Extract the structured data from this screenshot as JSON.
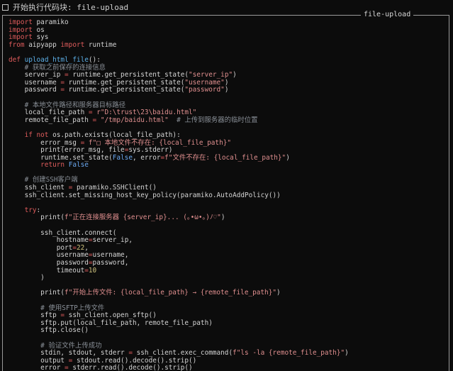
{
  "header": {
    "text": "开始执行代码块: file-upload"
  },
  "panel": {
    "title": "file-upload"
  },
  "code_lines": [
    [
      [
        "kw",
        "import"
      ],
      [
        "p",
        " paramiko"
      ]
    ],
    [
      [
        "kw",
        "import"
      ],
      [
        "p",
        " os"
      ]
    ],
    [
      [
        "kw",
        "import"
      ],
      [
        "p",
        " sys"
      ]
    ],
    [
      [
        "kw",
        "from"
      ],
      [
        "p",
        " aipyapp "
      ],
      [
        "kw",
        "import"
      ],
      [
        "p",
        " runtime"
      ]
    ],
    [],
    [
      [
        "kw",
        "def"
      ],
      [
        "p",
        " "
      ],
      [
        "fn",
        "upload_html_file"
      ],
      [
        "p",
        "():"
      ]
    ],
    [
      [
        "p",
        "    "
      ],
      [
        "com",
        "# 获取之前保存的连接信息"
      ]
    ],
    [
      [
        "p",
        "    server_ip "
      ],
      [
        "op",
        "="
      ],
      [
        "p",
        " runtime.get_persistent_state("
      ],
      [
        "str",
        "\"server_ip\""
      ],
      [
        "p",
        ")"
      ]
    ],
    [
      [
        "p",
        "    username "
      ],
      [
        "op",
        "="
      ],
      [
        "p",
        " runtime.get_persistent_state("
      ],
      [
        "str",
        "\"username\""
      ],
      [
        "p",
        ")"
      ]
    ],
    [
      [
        "p",
        "    password "
      ],
      [
        "op",
        "="
      ],
      [
        "p",
        " runtime.get_persistent_state("
      ],
      [
        "str",
        "\"password\""
      ],
      [
        "p",
        ")"
      ]
    ],
    [],
    [
      [
        "p",
        "    "
      ],
      [
        "com",
        "# 本地文件路径和服务器目标路径"
      ]
    ],
    [
      [
        "p",
        "    local_file_path "
      ],
      [
        "op",
        "="
      ],
      [
        "p",
        " "
      ],
      [
        "str",
        "r\"D:\\trust\\23\\baidu.html\""
      ]
    ],
    [
      [
        "p",
        "    remote_file_path "
      ],
      [
        "op",
        "="
      ],
      [
        "p",
        " "
      ],
      [
        "str",
        "\"/tmp/baidu.html\""
      ],
      [
        "p",
        "  "
      ],
      [
        "com",
        "# 上传到服务器的临时位置"
      ]
    ],
    [],
    [
      [
        "p",
        "    "
      ],
      [
        "kw",
        "if not"
      ],
      [
        "p",
        " os.path.exists(local_file_path):"
      ]
    ],
    [
      [
        "p",
        "        error_msg "
      ],
      [
        "op",
        "="
      ],
      [
        "p",
        " "
      ],
      [
        "str",
        "f\"□ 本地文件不存在: {local_file_path}\""
      ]
    ],
    [
      [
        "p",
        "        print(error_msg, file"
      ],
      [
        "op",
        "="
      ],
      [
        "p",
        "sys.stderr)"
      ]
    ],
    [
      [
        "p",
        "        runtime.set_state("
      ],
      [
        "cn",
        "False"
      ],
      [
        "p",
        ", error"
      ],
      [
        "op",
        "="
      ],
      [
        "str",
        "f\"文件不存在: {local_file_path}\""
      ],
      [
        "p",
        ")"
      ]
    ],
    [
      [
        "p",
        "        "
      ],
      [
        "kw",
        "return"
      ],
      [
        "p",
        " "
      ],
      [
        "cn",
        "False"
      ]
    ],
    [],
    [
      [
        "p",
        "    "
      ],
      [
        "com",
        "# 创建SSH客户端"
      ]
    ],
    [
      [
        "p",
        "    ssh_client "
      ],
      [
        "op",
        "="
      ],
      [
        "p",
        " paramiko.SSHClient()"
      ]
    ],
    [
      [
        "p",
        "    ssh_client.set_missing_host_key_policy(paramiko.AutoAddPolicy())"
      ]
    ],
    [],
    [
      [
        "p",
        "    "
      ],
      [
        "kw",
        "try"
      ],
      [
        "p",
        ":"
      ]
    ],
    [
      [
        "p",
        "        print("
      ],
      [
        "str",
        "f\"正在连接服务器 {server_ip}... (｡•ω•｡)ﾉ♡\""
      ],
      [
        "p",
        ")"
      ]
    ],
    [],
    [
      [
        "p",
        "        ssh_client.connect("
      ]
    ],
    [
      [
        "p",
        "            hostname"
      ],
      [
        "op",
        "="
      ],
      [
        "p",
        "server_ip,"
      ]
    ],
    [
      [
        "p",
        "            port"
      ],
      [
        "op",
        "="
      ],
      [
        "num",
        "22"
      ],
      [
        "p",
        ","
      ]
    ],
    [
      [
        "p",
        "            username"
      ],
      [
        "op",
        "="
      ],
      [
        "p",
        "username,"
      ]
    ],
    [
      [
        "p",
        "            password"
      ],
      [
        "op",
        "="
      ],
      [
        "p",
        "password,"
      ]
    ],
    [
      [
        "p",
        "            timeout"
      ],
      [
        "op",
        "="
      ],
      [
        "num",
        "10"
      ]
    ],
    [
      [
        "p",
        "        )"
      ]
    ],
    [],
    [
      [
        "p",
        "        print("
      ],
      [
        "str",
        "f\"开始上传文件: {local_file_path} → {remote_file_path}\""
      ],
      [
        "p",
        ")"
      ]
    ],
    [],
    [
      [
        "p",
        "        "
      ],
      [
        "com",
        "# 使用SFTP上传文件"
      ]
    ],
    [
      [
        "p",
        "        sftp "
      ],
      [
        "op",
        "="
      ],
      [
        "p",
        " ssh_client.open_sftp()"
      ]
    ],
    [
      [
        "p",
        "        sftp.put(local_file_path, remote_file_path)"
      ]
    ],
    [
      [
        "p",
        "        sftp.close()"
      ]
    ],
    [],
    [
      [
        "p",
        "        "
      ],
      [
        "com",
        "# 验证文件上传成功"
      ]
    ],
    [
      [
        "p",
        "        stdin, stdout, stderr "
      ],
      [
        "op",
        "="
      ],
      [
        "p",
        " ssh_client.exec_command("
      ],
      [
        "str",
        "f\"ls -la {remote_file_path}\""
      ],
      [
        "p",
        ")"
      ]
    ],
    [
      [
        "p",
        "        output "
      ],
      [
        "op",
        "="
      ],
      [
        "p",
        " stdout.read().decode().strip()"
      ]
    ],
    [
      [
        "p",
        "        error "
      ],
      [
        "op",
        "="
      ],
      [
        "p",
        " stderr.read().decode().strip()"
      ]
    ]
  ]
}
